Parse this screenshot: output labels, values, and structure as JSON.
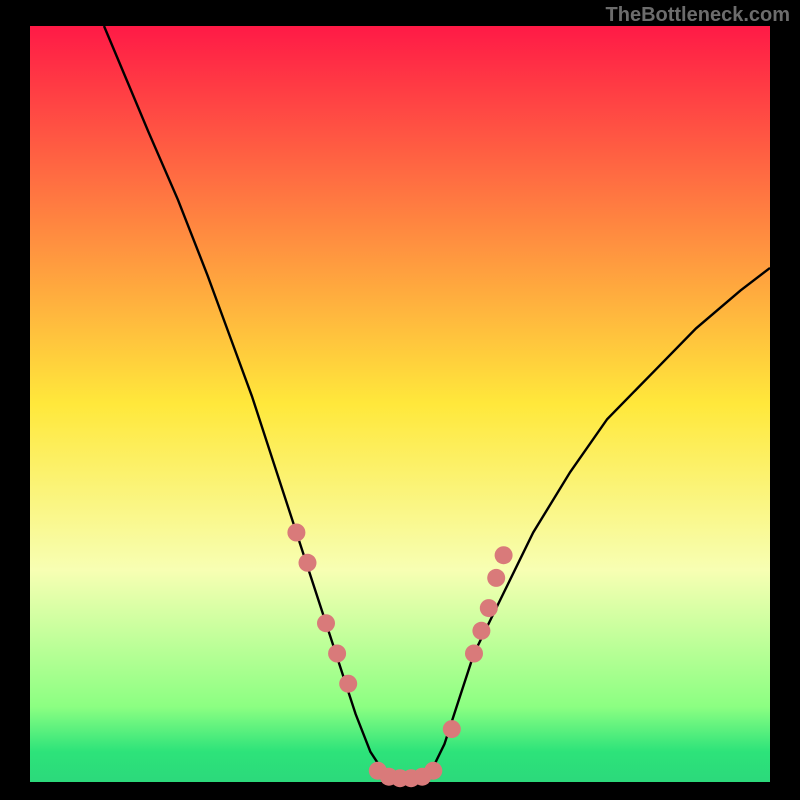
{
  "watermark": "TheBottleneck.com",
  "colors": {
    "black": "#000000",
    "curve": "#000000",
    "dots": "#d97a7a",
    "grad_top": "#ff1a46",
    "grad_mid": "#ffe83b",
    "grad_low": "#f7ffb3",
    "grad_green1": "#8cff82",
    "grad_green2": "#2de37a",
    "grad_green3": "#2cd97b"
  },
  "chart_data": {
    "type": "line",
    "title": "",
    "xlabel": "",
    "ylabel": "",
    "xlim": [
      0,
      100
    ],
    "ylim": [
      0,
      100
    ],
    "grid": false,
    "legend": false,
    "description": "V-shaped bottleneck curve with flat minimum plateau near 0 and overlaid pink dot markers near the valley",
    "x": [
      10,
      13,
      16,
      20,
      24,
      27,
      30,
      33,
      36,
      38,
      40,
      42,
      44,
      46,
      48,
      50,
      52,
      54,
      56,
      58,
      60,
      64,
      68,
      73,
      78,
      84,
      90,
      96,
      100
    ],
    "y": [
      100,
      93,
      86,
      77,
      67,
      59,
      51,
      42,
      33,
      27,
      21,
      15,
      9,
      4,
      1,
      0,
      0,
      1,
      5,
      11,
      17,
      25,
      33,
      41,
      48,
      54,
      60,
      65,
      68
    ],
    "series_dots": {
      "name": "markers",
      "points": [
        {
          "x": 36,
          "y": 33
        },
        {
          "x": 37.5,
          "y": 29
        },
        {
          "x": 40,
          "y": 21
        },
        {
          "x": 41.5,
          "y": 17
        },
        {
          "x": 43,
          "y": 13
        },
        {
          "x": 47,
          "y": 1.5
        },
        {
          "x": 48.5,
          "y": 0.7
        },
        {
          "x": 50,
          "y": 0.5
        },
        {
          "x": 51.5,
          "y": 0.5
        },
        {
          "x": 53,
          "y": 0.7
        },
        {
          "x": 54.5,
          "y": 1.5
        },
        {
          "x": 57,
          "y": 7
        },
        {
          "x": 60,
          "y": 17
        },
        {
          "x": 61,
          "y": 20
        },
        {
          "x": 62,
          "y": 23
        },
        {
          "x": 63,
          "y": 27
        },
        {
          "x": 64,
          "y": 30
        }
      ]
    }
  }
}
